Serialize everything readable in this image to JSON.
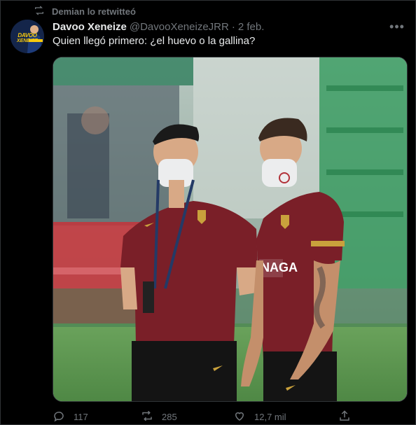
{
  "retweet": {
    "text": "Demian lo retwitteó",
    "icon": "retweet-icon"
  },
  "tweet": {
    "display_name": "Davoo Xeneize",
    "handle": "@DavooXeneizeJRR",
    "separator": "·",
    "date": "2 feb.",
    "text": "Quien llegó primero: ¿el huevo o la gallina?",
    "avatar_text": "DAVOO",
    "avatar_sub": "XENEIZE",
    "media": {
      "sponsor_text": "NAGA"
    }
  },
  "actions": {
    "replies": "117",
    "retweets": "285",
    "likes": "12,7 mil"
  },
  "colors": {
    "background": "#000000",
    "text": "#e7e9ea",
    "muted": "#71767b",
    "jersey": "#7a1f28",
    "badge": "#c9a13c"
  }
}
